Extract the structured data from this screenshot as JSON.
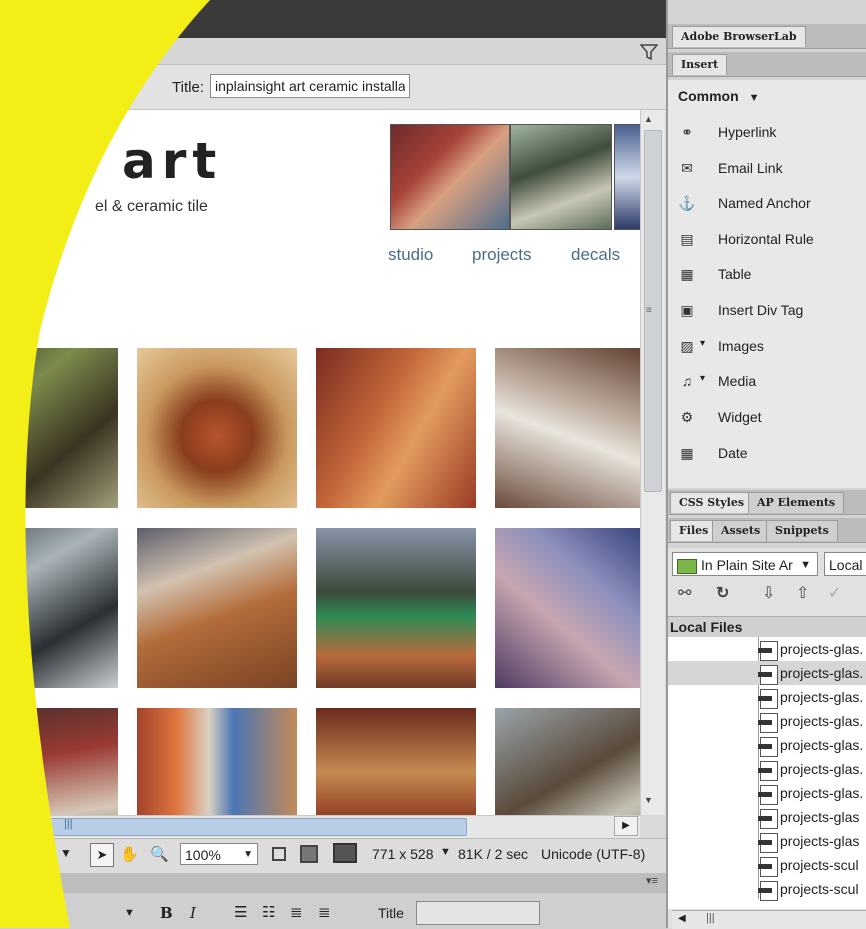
{
  "document": {
    "title_label": "Title:",
    "title_value": "inplainsight art ceramic installa"
  },
  "page": {
    "heading": "art",
    "tagline": "el & ceramic tile",
    "nav": [
      "studio",
      "projects",
      "decals"
    ]
  },
  "status_bar": {
    "zoom": "100%",
    "dimensions": "771 x 528",
    "download": "81K / 2 sec",
    "encoding": "Unicode (UTF-8)"
  },
  "properties": {
    "bold": "B",
    "italic": "I",
    "title_label": "Title"
  },
  "panels": {
    "browserlab_tab": "Adobe BrowserLab",
    "insert_tab": "Insert",
    "category": "Common",
    "insert_items": [
      {
        "label": "Hyperlink",
        "icon": "hyperlink-icon"
      },
      {
        "label": "Email Link",
        "icon": "email-icon"
      },
      {
        "label": "Named Anchor",
        "icon": "anchor-icon"
      },
      {
        "label": "Horizontal Rule",
        "icon": "horizontal-rule-icon"
      },
      {
        "label": "Table",
        "icon": "table-icon"
      },
      {
        "label": "Insert Div Tag",
        "icon": "div-tag-icon"
      },
      {
        "label": "Images",
        "icon": "image-icon"
      },
      {
        "label": "Media",
        "icon": "media-icon"
      },
      {
        "label": "Widget",
        "icon": "widget-icon"
      },
      {
        "label": "Date",
        "icon": "calendar-icon"
      }
    ],
    "css_tabs": [
      "CSS Styles",
      "AP Elements"
    ],
    "files_tabs": [
      "Files",
      "Assets",
      "Snippets"
    ],
    "site_name": "In Plain Site Ar",
    "view_name": "Local",
    "local_files_header": "Local Files",
    "files": [
      "projects-glas.",
      "projects-glas.",
      "projects-glas.",
      "projects-glas.",
      "projects-glas.",
      "projects-glas.",
      "projects-glas.",
      "projects-glas",
      "projects-glas",
      "projects-scul",
      "projects-scul"
    ],
    "selected_file_index": 1
  },
  "colors": {
    "accent_yellow": "#f2ee16",
    "nav_link": "#4b6e87",
    "hscroll_thumb": "#b9cde6"
  }
}
